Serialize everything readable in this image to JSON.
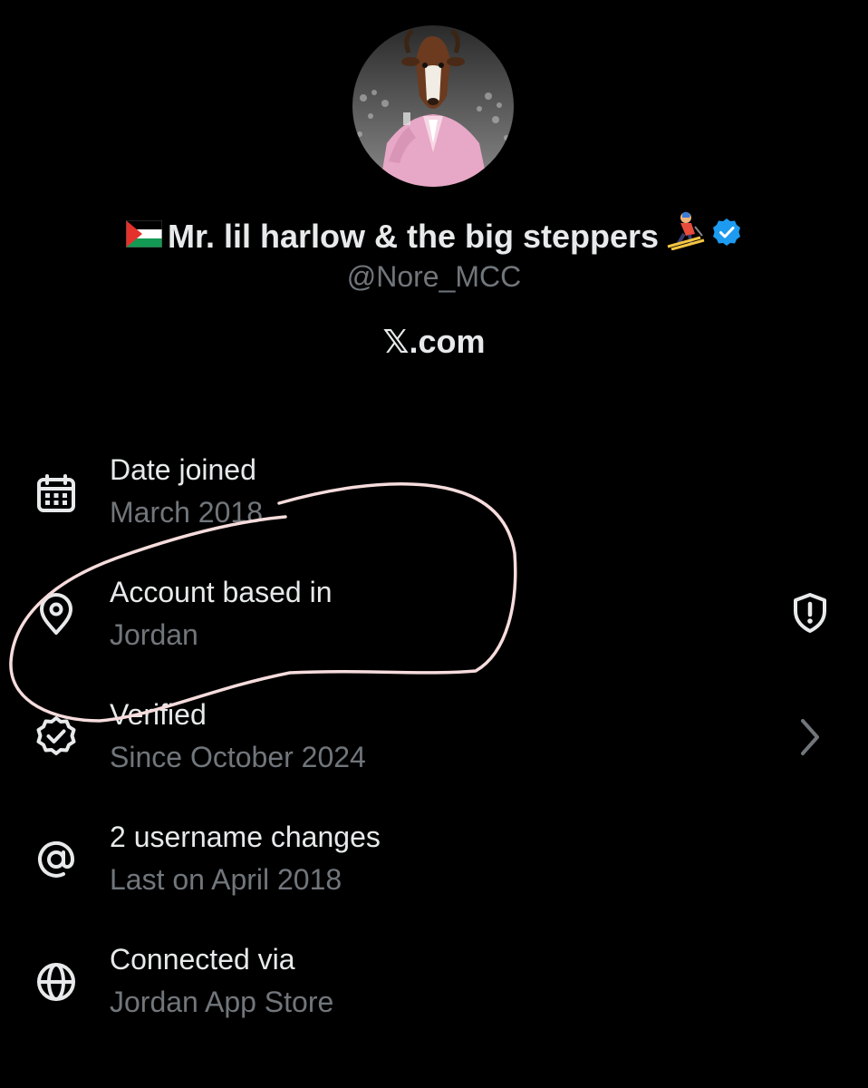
{
  "profile": {
    "display_name": "Mr. lil harlow & the big steppers",
    "handle": "@Nore_MCC",
    "website": "𝕏.com",
    "name_prefix_icon": "palestine-flag-icon",
    "name_suffix_icon": "skier-icon",
    "verified_badge": "verified-badge-icon",
    "verified_color": "#1d9bf0"
  },
  "details": [
    {
      "icon": "calendar-icon",
      "title": "Date joined",
      "value": "March 2018"
    },
    {
      "icon": "location-pin-icon",
      "title": "Account based in",
      "value": "Jordan",
      "trailing_icon": "shield-alert-icon"
    },
    {
      "icon": "verified-check-icon",
      "title": "Verified",
      "value": "Since October 2024",
      "trailing_icon": "chevron-right-icon"
    },
    {
      "icon": "at-sign-icon",
      "title": "2 username changes",
      "value": "Last on April 2018"
    },
    {
      "icon": "globe-icon",
      "title": "Connected via",
      "value": "Jordan App Store"
    }
  ],
  "annotation": {
    "shape": "hand-drawn-loop",
    "color": "#f6dcdc",
    "encircles": "Account based in"
  }
}
